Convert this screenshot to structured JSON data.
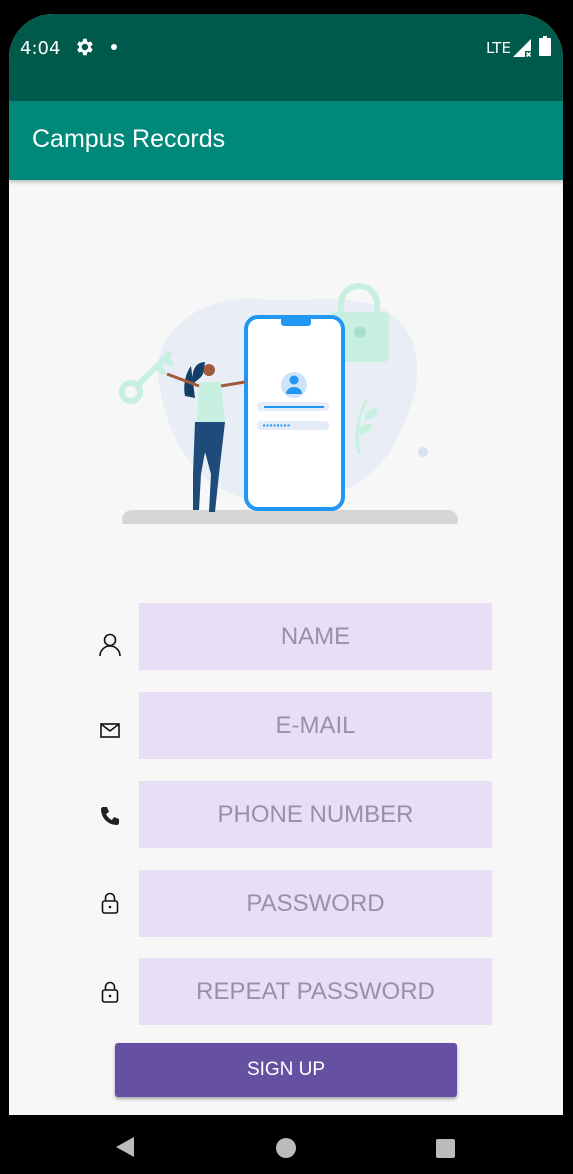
{
  "status_bar": {
    "time": "4:04",
    "network": "LTE"
  },
  "app_bar": {
    "title": "Campus Records"
  },
  "form": {
    "fields": [
      {
        "placeholder": "NAME",
        "icon": "person-icon"
      },
      {
        "placeholder": "E-MAIL",
        "icon": "mail-icon"
      },
      {
        "placeholder": "PHONE NUMBER",
        "icon": "phone-icon"
      },
      {
        "placeholder": "PASSWORD",
        "icon": "lock-icon"
      },
      {
        "placeholder": "REPEAT PASSWORD",
        "icon": "lock-icon"
      }
    ],
    "signup_label": "SIGN UP"
  },
  "colors": {
    "status_bar": "#005a4c",
    "app_bar": "#00887a",
    "field_background": "#e8dff6",
    "button": "#6650a2"
  }
}
